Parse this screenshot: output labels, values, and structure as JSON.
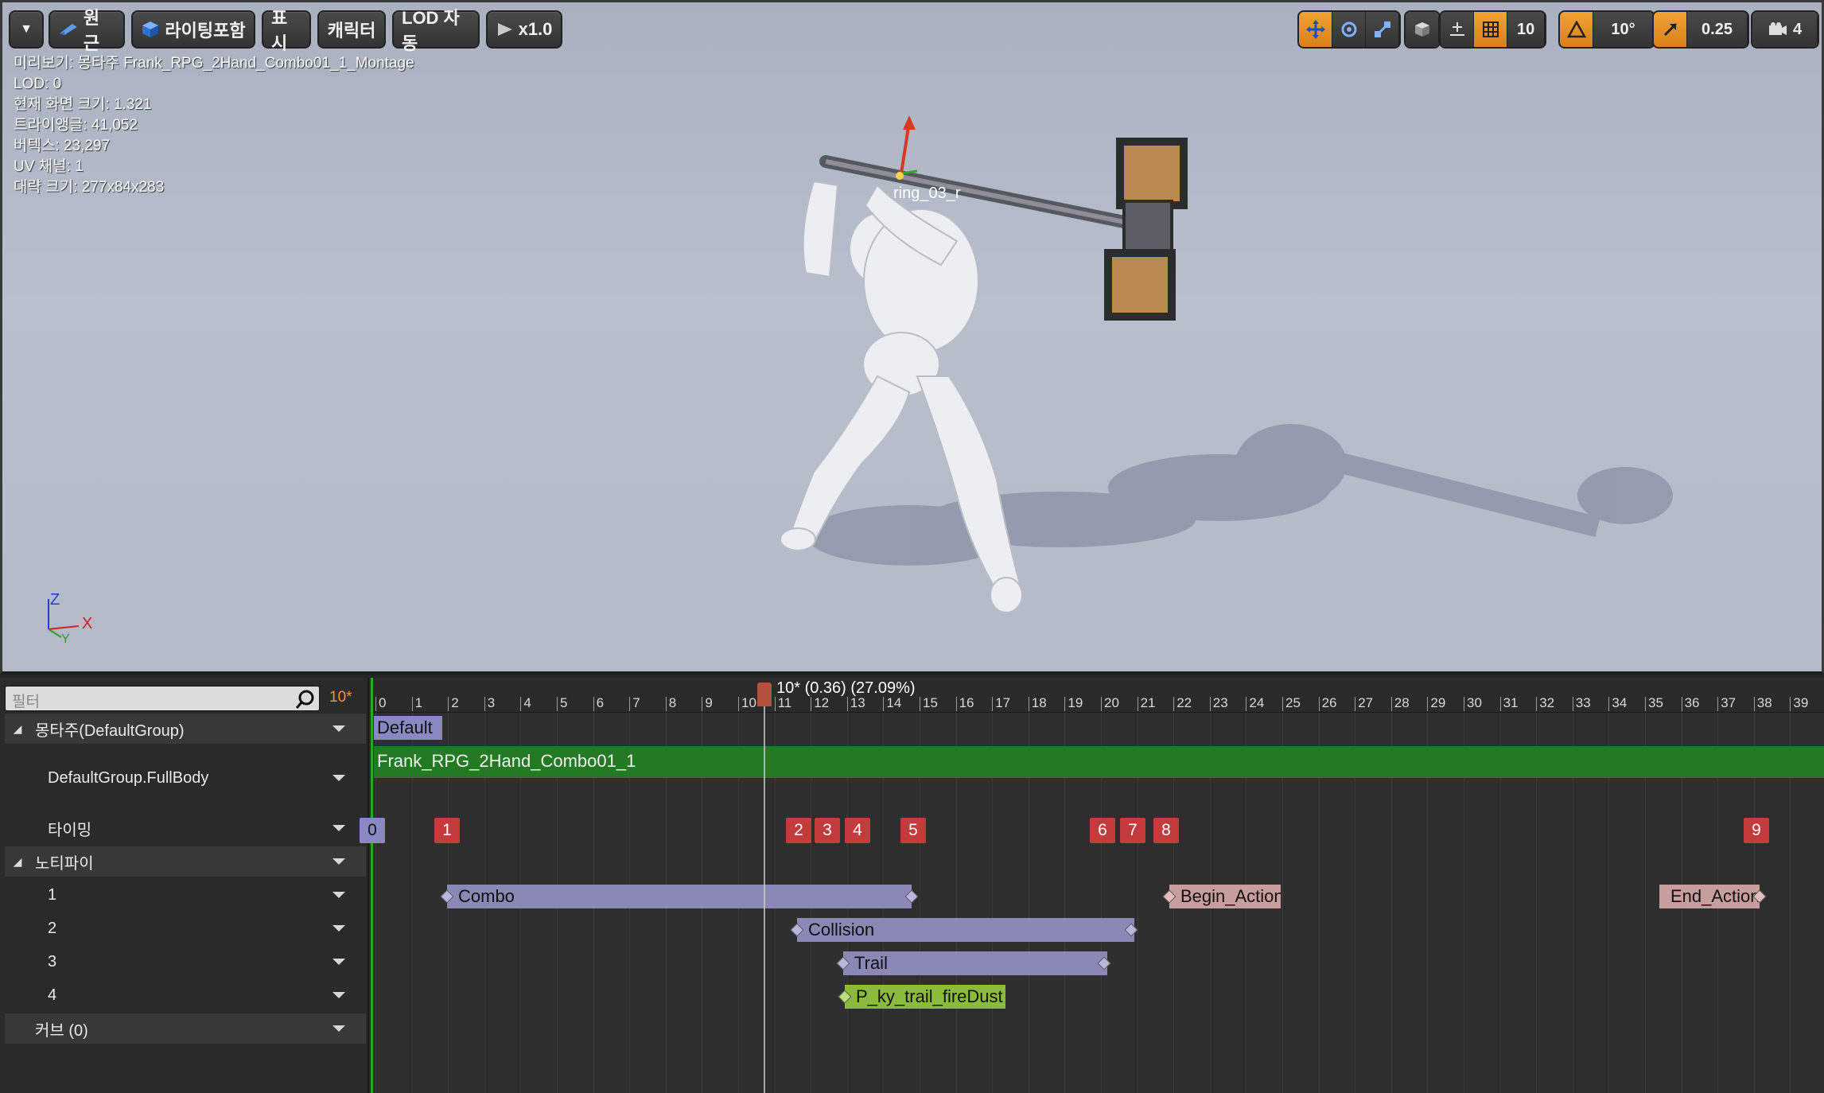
{
  "toolbar": {
    "menu_caret": "▼",
    "perspective_label": "원근",
    "lighting_label": "라이팅포함",
    "show_label": "표시",
    "character_label": "캐릭터",
    "lod_label": "LOD 자동",
    "speed_label": "x1.0",
    "grid_snap_value": "10",
    "rotation_snap_value": "10°",
    "scale_snap_value": "0.25",
    "camera_speed_value": "4"
  },
  "viewport_info": {
    "preview": "미리보기: 몽타주 Frank_RPG_2Hand_Combo01_1_Montage",
    "lod": "LOD: 0",
    "screen_size": "현재 화면 크기: 1.321",
    "triangles": "트라이앵글: 41,052",
    "vertices": "버텍스: 23,297",
    "uv_channels": "UV 채널: 1",
    "approx_size": "대략 크기: 277x84x283",
    "bone_label": "ring_03_r",
    "axis_z": "Z",
    "axis_x": "X",
    "axis_y": "Y"
  },
  "tracks_panel": {
    "filter_placeholder": "필터",
    "frame_indicator": "10*",
    "montage_group": "몽타주(DefaultGroup)",
    "slot_name": "DefaultGroup.FullBody",
    "timing": "타이밍",
    "notifies": "노티파이",
    "notify_tracks": [
      "1",
      "2",
      "3",
      "4"
    ],
    "curves": "커브  (0)"
  },
  "timeline": {
    "playhead_text": "10* (0.36) (27.09%)",
    "frames": [
      "0",
      "1",
      "2",
      "3",
      "4",
      "5",
      "6",
      "7",
      "8",
      "9",
      "10",
      "11",
      "12",
      "13",
      "14",
      "15",
      "16",
      "17",
      "18",
      "19",
      "20",
      "21",
      "22",
      "23",
      "24",
      "25",
      "26",
      "27",
      "28",
      "29",
      "30",
      "31",
      "32",
      "33",
      "34",
      "35",
      "36",
      "37",
      "38",
      "39"
    ],
    "section_label": "Default",
    "slot_anim": "Frank_RPG_2Hand_Combo01_1",
    "timing_markers": [
      "0",
      "1",
      "2",
      "3",
      "4",
      "5",
      "6",
      "7",
      "8",
      "9"
    ],
    "notifies": [
      {
        "track": 1,
        "label": "Combo"
      },
      {
        "track": 1,
        "label": "Begin_Action"
      },
      {
        "track": 1,
        "label": "End_Action"
      },
      {
        "track": 2,
        "label": "Collision"
      },
      {
        "track": 3,
        "label": "Trail"
      },
      {
        "track": 4,
        "label": "P_ky_trail_fireDust"
      }
    ]
  },
  "colors": {
    "accent_orange": "#f2a233",
    "timing_red": "#c33b3b",
    "slot_green": "#247a22",
    "notify_purple": "#8a88b5"
  }
}
